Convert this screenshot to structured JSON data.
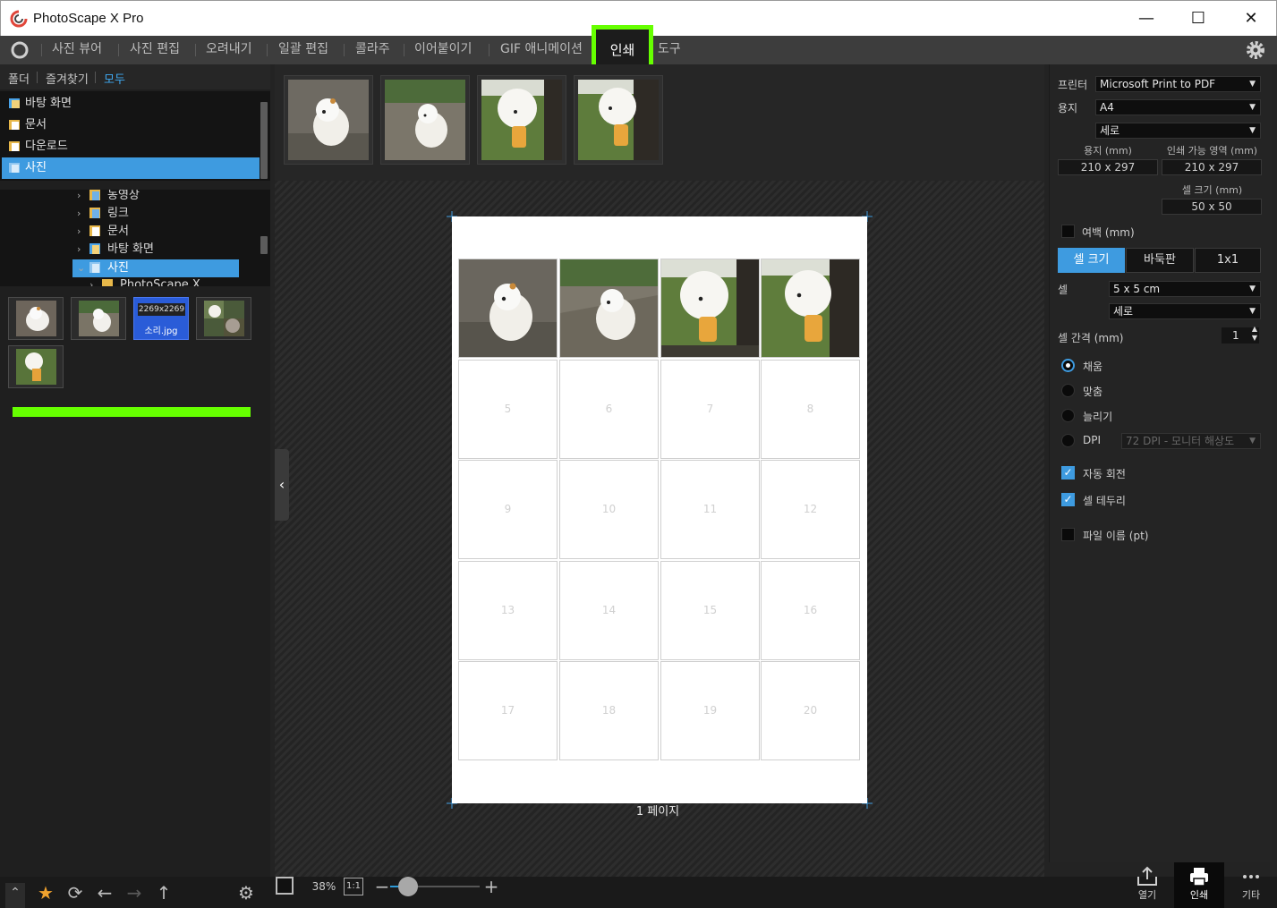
{
  "window": {
    "title": "PhotoScape X Pro"
  },
  "menu": {
    "items": [
      "사진 뷰어",
      "사진 편집",
      "오려내기",
      "일괄 편집",
      "콜라주",
      "이어붙이기",
      "GIF 애니메이션",
      "인쇄",
      "도구"
    ],
    "active": "인쇄"
  },
  "left": {
    "tabs": [
      "폴더",
      "즐겨찾기",
      "모두"
    ],
    "active_tab": "모두",
    "quick_access": [
      "바탕 화면",
      "문서",
      "다운로드",
      "사진"
    ],
    "tree": [
      "농영상",
      "링크",
      "문서",
      "바탕 화면",
      "사진",
      "PhotoScape X"
    ],
    "thumb_dim": "2269x2269",
    "thumb_name": "소리.jpg"
  },
  "bottom": {
    "zoom": "38%",
    "one_to_one": "1:1"
  },
  "canvas": {
    "page_label": "1 페이지",
    "empty_cells": [
      "5",
      "6",
      "7",
      "8",
      "9",
      "10",
      "11",
      "12",
      "13",
      "14",
      "15",
      "16",
      "17",
      "18",
      "19",
      "20"
    ]
  },
  "right": {
    "printer_label": "프린터",
    "printer_value": "Microsoft Print to PDF",
    "paper_label": "용지",
    "paper_value": "A4",
    "orientation_value": "세로",
    "paper_mm_label": "용지 (mm)",
    "printable_label": "인쇄 가능 영역 (mm)",
    "paper_mm_value": "210 x 297",
    "printable_value": "210 x 297",
    "cell_size_label": "셀 크기 (mm)",
    "cell_size_value": "50 x 50",
    "margin_label": "여백 (mm)",
    "mode_buttons": [
      "셀 크기",
      "바둑판",
      "1x1"
    ],
    "cell_label": "셀",
    "cell_value": "5 x 5 cm",
    "cell_orientation": "세로",
    "spacing_label": "셀 간격 (mm)",
    "spacing_value": "1",
    "fit_options": [
      "채움",
      "맞춤",
      "늘리기",
      "DPI"
    ],
    "dpi_value": "72 DPI - 모니터 해상도",
    "auto_rotate": "자동 회전",
    "cell_border": "셀 테두리",
    "file_name": "파일 이름 (pt)"
  },
  "actions": [
    "열기",
    "인쇄",
    "기타"
  ],
  "colors": {
    "accent": "#3e9be0",
    "highlight": "#66ff00"
  }
}
